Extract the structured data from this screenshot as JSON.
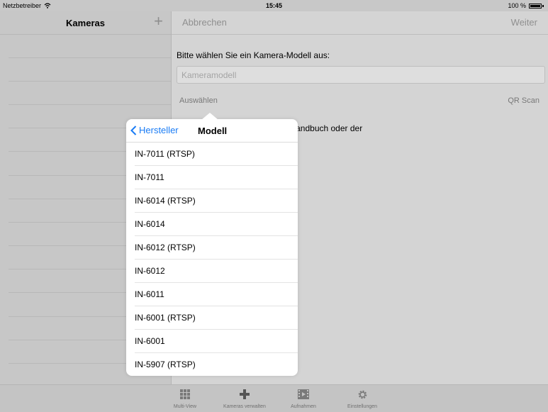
{
  "status_bar": {
    "carrier": "Netzbetreiber",
    "time": "15:45",
    "battery": "100 %"
  },
  "left_pane": {
    "title": "Kameras",
    "add_symbol": "+"
  },
  "right_pane": {
    "cancel_label": "Abbrechen",
    "next_label": "Weiter",
    "prompt": "Bitte wählen Sie ein Kamera-Modell aus:",
    "model_placeholder": "Kameramodell",
    "select_label": "Auswählen",
    "qr_label": "QR Scan",
    "hint_text": "ung können Sie dem Benutzerhandbuch oder der"
  },
  "popover": {
    "back_label": "Hersteller",
    "title": "Modell",
    "items": [
      "IN-7011 (RTSP)",
      "IN-7011",
      "IN-6014 (RTSP)",
      "IN-6014",
      "IN-6012 (RTSP)",
      "IN-6012",
      "IN-6011",
      "IN-6001 (RTSP)",
      "IN-6001",
      "IN-5907 (RTSP)"
    ]
  },
  "tab_bar": {
    "tabs": [
      {
        "label": "Multi-View",
        "icon": "grid-icon"
      },
      {
        "label": "Kameras verwalten",
        "icon": "plus-icon"
      },
      {
        "label": "Aufnahmen",
        "icon": "film-icon"
      },
      {
        "label": "Einstellungen",
        "icon": "gear-icon"
      }
    ]
  },
  "colors": {
    "accent": "#1a7cf5",
    "popover_bg": "#ffffff",
    "dimmed_bg": "#d4d4d4"
  }
}
